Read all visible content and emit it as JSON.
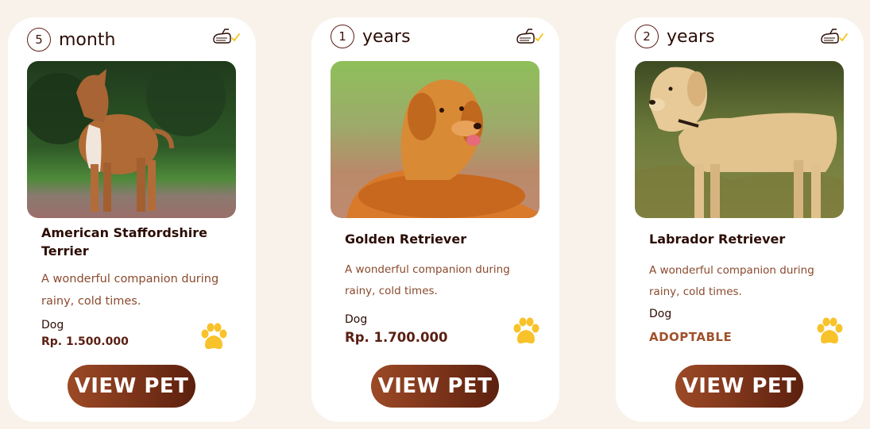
{
  "pets": [
    {
      "age_number": "5",
      "age_unit": "month",
      "name": "American Staffordshire Terrier",
      "description": "A wonderful companion during rainy, cold times.",
      "type": "Dog",
      "price": "Rp. 1.500.000",
      "button_label": "VIEW PET",
      "icon": "pet-shampoo-icon",
      "paw_icon": "paw-icon"
    },
    {
      "age_number": "1",
      "age_unit": "years",
      "name": "Golden Retriever",
      "description": "A wonderful companion during rainy, cold times.",
      "type": "Dog",
      "price": "Rp. 1.700.000",
      "button_label": "VIEW PET",
      "icon": "pet-shampoo-icon",
      "paw_icon": "paw-icon"
    },
    {
      "age_number": "2",
      "age_unit": "years",
      "name": "Labrador Retriever",
      "description": "A wonderful companion during rainy, cold times.",
      "type": "Dog",
      "price": "ADOPTABLE",
      "button_label": "VIEW PET",
      "icon": "pet-shampoo-icon",
      "paw_icon": "paw-icon"
    }
  ],
  "colors": {
    "background": "#f8f2ea",
    "card": "#ffffff",
    "heading": "#2c0d05",
    "description": "#8a4a2e",
    "button": "#7a3319",
    "paw": "#f8c22a",
    "adoptable": "#a0522d"
  }
}
